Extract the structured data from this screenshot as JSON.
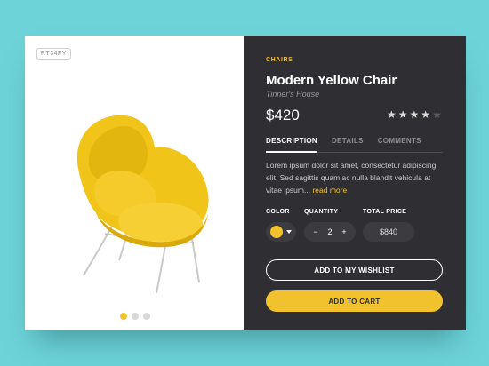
{
  "product": {
    "sku": "RT34FY",
    "category": "CHAIRS",
    "title": "Modern Yellow Chair",
    "brand": "Tinner's House",
    "price": "$420",
    "rating": 4,
    "rating_max": 5
  },
  "gallery": {
    "image": "yellow-womb-chair",
    "slides": 3,
    "active_slide": 1
  },
  "tabs": [
    {
      "label": "DESCRIPTION",
      "active": true
    },
    {
      "label": "DETAILS",
      "active": false
    },
    {
      "label": "COMMENTS",
      "active": false
    }
  ],
  "description": {
    "text": "Lorem ipsum dolor sit amet, consectetur adipiscing elit. Sed sagittis quam ac nulla blandit vehicula at vitae ipsum...",
    "read_more": "read more"
  },
  "options": {
    "color_label": "COLOR",
    "color_value": "#f2c12e",
    "quantity_label": "QUANTITY",
    "quantity": "2",
    "minus": "−",
    "plus": "+",
    "total_label": "TOTAL PRICE",
    "total": "$840"
  },
  "actions": {
    "wishlist": "ADD TO MY WISHLIST",
    "cart": "ADD TO CART"
  },
  "colors": {
    "background": "#6dd3d9",
    "panel": "#2f2f33",
    "accent": "#f2c12e"
  },
  "icons": {
    "star": "star-icon",
    "caret": "chevron-down-icon"
  }
}
